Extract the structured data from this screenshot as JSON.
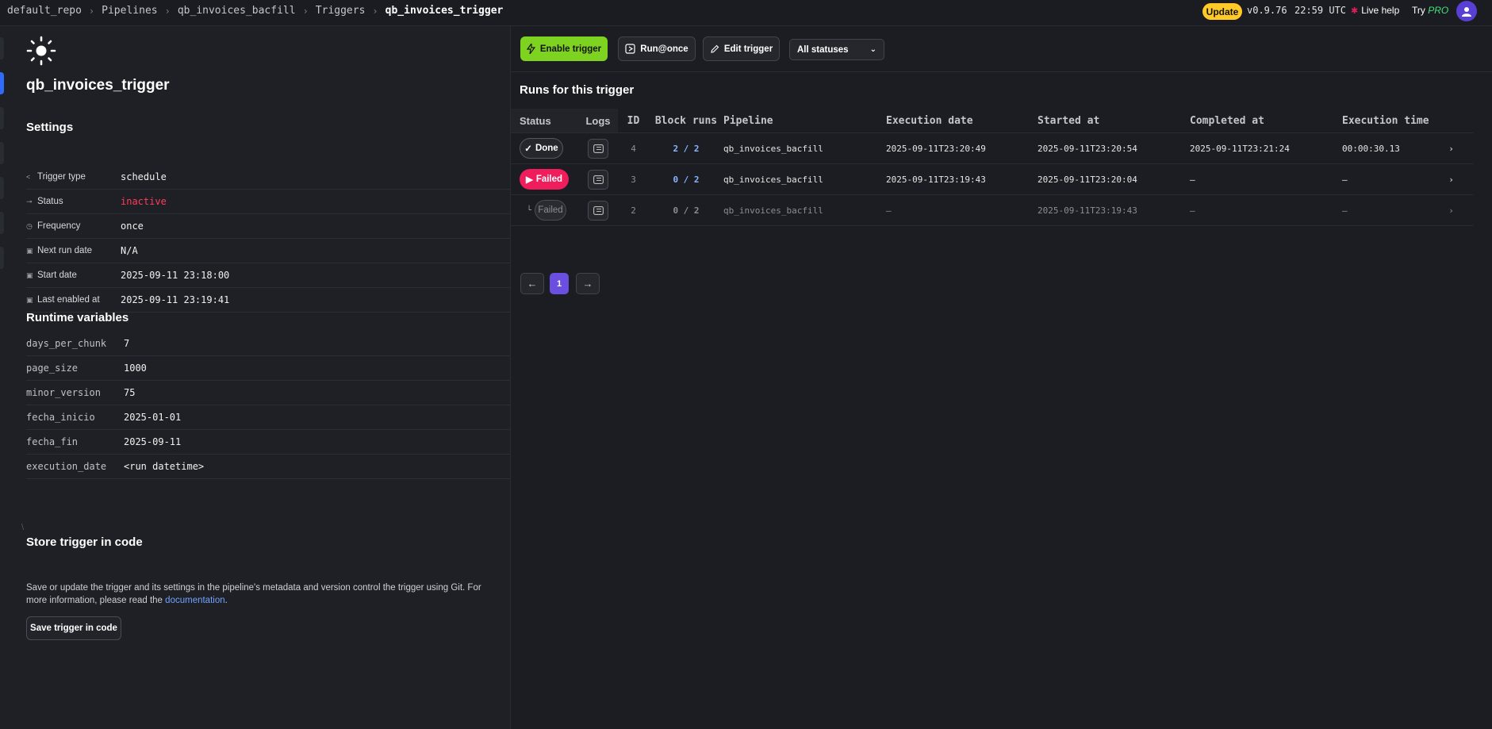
{
  "breadcrumbs": [
    "default_repo",
    "Pipelines",
    "qb_invoices_bacfill",
    "Triggers",
    "qb_invoices_trigger"
  ],
  "header": {
    "update_label": "Update",
    "version": "v0.9.76",
    "time": "22:59 UTC",
    "live_help": "Live help",
    "try_label": "Try",
    "pro_label": "PRO"
  },
  "trigger": {
    "name": "qb_invoices_trigger"
  },
  "settings": {
    "title": "Settings",
    "rows": [
      {
        "key": "Trigger type",
        "value": "schedule"
      },
      {
        "key": "Status",
        "value": "inactive"
      },
      {
        "key": "Frequency",
        "value": "once"
      },
      {
        "key": "Next run date",
        "value": "N/A"
      },
      {
        "key": "Start date",
        "value": "2025-09-11 23:18:00"
      },
      {
        "key": "Last enabled at",
        "value": "2025-09-11 23:19:41"
      }
    ]
  },
  "runtime": {
    "title": "Runtime variables",
    "rows": [
      {
        "key": "days_per_chunk",
        "value": "7"
      },
      {
        "key": "page_size",
        "value": "1000"
      },
      {
        "key": "minor_version",
        "value": "75"
      },
      {
        "key": "fecha_inicio",
        "value": "2025-01-01"
      },
      {
        "key": "fecha_fin",
        "value": "2025-09-11"
      },
      {
        "key": "execution_date",
        "value": "<run datetime>"
      }
    ]
  },
  "store": {
    "title": "Store trigger in code",
    "text": "Save or update the trigger and its settings in the pipeline's metadata and version control the trigger using Git. For more information, please read the",
    "link": "documentation",
    "after_link": ".",
    "button": "Save trigger in code"
  },
  "toolbar": {
    "enable": "Enable trigger",
    "run_once": "Run@once",
    "edit": "Edit trigger",
    "status_filter": "All statuses"
  },
  "runs": {
    "title": "Runs for this trigger",
    "columns": [
      "Status",
      "Logs",
      "ID",
      "Block runs",
      "Pipeline",
      "Execution date",
      "Started at",
      "Completed at",
      "Execution time"
    ],
    "rows": [
      {
        "status": "Done",
        "id": "4",
        "block_runs": "2 / 2",
        "pipeline": "qb_invoices_bacfill",
        "execution_date": "2025-09-11T23:20:49",
        "started_at": "2025-09-11T23:20:54",
        "completed_at": "2025-09-11T23:21:24",
        "execution_time": "00:00:30.13"
      },
      {
        "status": "Failed",
        "id": "3",
        "block_runs": "0 / 2",
        "pipeline": "qb_invoices_bacfill",
        "execution_date": "2025-09-11T23:19:43",
        "started_at": "2025-09-11T23:20:04",
        "completed_at": "–",
        "execution_time": "–"
      },
      {
        "status": "Failed",
        "id": "2",
        "block_runs": "0 / 2",
        "pipeline": "qb_invoices_bacfill",
        "execution_date": "–",
        "started_at": "2025-09-11T23:19:43",
        "completed_at": "–",
        "execution_time": "–"
      }
    ]
  },
  "pagination": {
    "current": "1"
  },
  "colors": {
    "accent_green": "#7ed321",
    "failed_red": "#ef1d5c",
    "page_purple": "#6b4fe0",
    "link_blue": "#6fa3ff"
  }
}
